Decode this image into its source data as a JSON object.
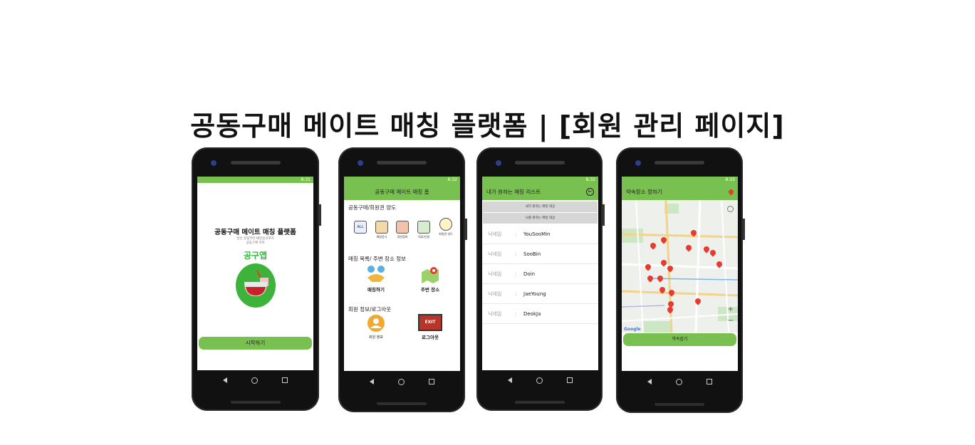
{
  "page_title": "공동구매 메이트 매칭 플랫폼 | [회원 관리 페이지]",
  "status_time": [
    "8:31",
    "8:32",
    "8:32",
    "8:33"
  ],
  "phone1": {
    "title": "공동구매 메이트 매칭 플랫폼",
    "subtitle1": "일인 살림부터 배달음식까지",
    "subtitle2": "공동구매 하자",
    "brand": "공구앱",
    "start_button": "시작하기"
  },
  "phone2": {
    "appbar_title": "공동구매 메이트 매칭 홈",
    "section1": "공동구매/회원권 양도",
    "categories": [
      "",
      "배달음식",
      "일반잡화",
      "의류/신발",
      "회원권 양도"
    ],
    "category_all": "ALL",
    "section2": "매칭 목록/ 주변 장소 정보",
    "matching": "매칭하기",
    "nearby": "주변 장소",
    "section3": "회원 정보/로그아웃",
    "member_info": "회원 정보",
    "exit_sign": "EXIT",
    "logout": "로그아웃"
  },
  "phone3": {
    "appbar_title": "내가 원하는 매칭 리스트",
    "btn_mine": "내가 원하는 매칭 대상",
    "btn_wants_me": "나를 원하는 매칭 대상",
    "nick_label": "닉네임",
    "colon": ":",
    "nicknames": [
      "YouSooMin",
      "SooBin",
      "Doin",
      "JaeYoung",
      "DeokJa"
    ]
  },
  "phone4": {
    "appbar_title": "약속장소 정하기",
    "confirm_button": "약속잡기",
    "map_brand": "Google",
    "zoom_in": "+",
    "zoom_out": "−"
  }
}
